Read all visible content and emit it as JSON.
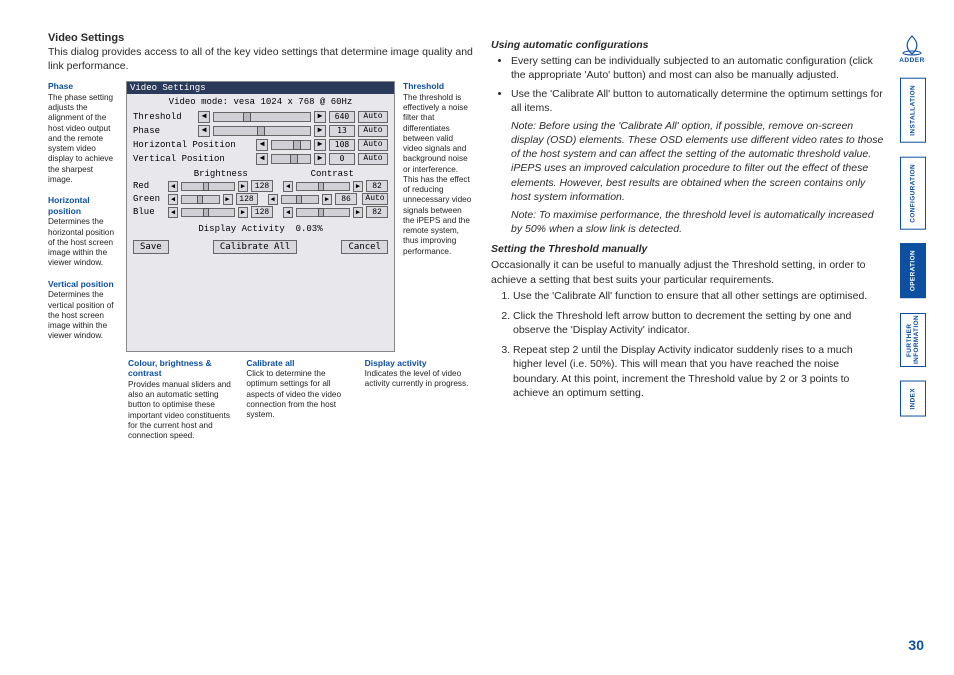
{
  "brand": "ADDER",
  "page_number": "30",
  "title": "Video Settings",
  "intro": "This dialog provides access to all of the key video settings that determine image quality and link performance.",
  "annotations": {
    "phase": {
      "title": "Phase",
      "body": "The phase setting adjusts the alignment of the host video output and the remote system video display to achieve the sharpest image."
    },
    "horizontal": {
      "title": "Horizontal position",
      "body": "Determines the horizontal position of the host screen image within the viewer window."
    },
    "vertical": {
      "title": "Vertical position",
      "body": "Determines the vertical position of the host screen image within the viewer window."
    },
    "threshold": {
      "title": "Threshold",
      "body": "The threshold is effectively a noise filter that differentiates between valid video signals and background noise or interference. This has the effect of reducing unnecessary video signals between the iPEPS and the remote system, thus improving performance."
    },
    "colour": {
      "title": "Colour, brightness & contrast",
      "body": "Provides manual sliders and also an automatic setting button to optimise these important video constituents for the current host and connection speed."
    },
    "calibrate": {
      "title": "Calibrate all",
      "body": "Click to determine the optimum settings for all aspects of video the video connection from the host system."
    },
    "activity": {
      "title": "Display activity",
      "body": "Indicates the level of video activity currently in progress."
    }
  },
  "screenshot": {
    "title": "Video Settings",
    "mode_line": "Video mode: vesa 1024 x 768 @ 60Hz",
    "rows": {
      "threshold": {
        "label": "Threshold",
        "value": "640",
        "btn": "Auto",
        "thumb": "30%"
      },
      "phase": {
        "label": "Phase",
        "value": "13",
        "btn": "Auto",
        "thumb": "45%"
      },
      "hpos": {
        "label": "Horizontal Position",
        "value": "108",
        "btn": "Auto",
        "thumb": "55%"
      },
      "vpos": {
        "label": "Vertical Position",
        "value": "0",
        "btn": "Auto",
        "thumb": "48%"
      }
    },
    "bc_header": {
      "b": "Brightness",
      "c": "Contrast"
    },
    "bc": {
      "red": {
        "label": "Red",
        "b": "128",
        "c": "82"
      },
      "green": {
        "label": "Green",
        "b": "128",
        "c": "86",
        "cbtn": "Auto"
      },
      "blue": {
        "label": "Blue",
        "b": "128",
        "c": "82"
      }
    },
    "activity_label": "Display Activity",
    "activity_value": "0.03%",
    "buttons": {
      "save": "Save",
      "cal": "Calibrate All",
      "cancel": "Cancel"
    }
  },
  "right": {
    "head1": "Using automatic configurations",
    "b1": "Every setting can be individually subjected to an automatic configuration (click the appropriate 'Auto' button) and most can also be manually adjusted.",
    "b2": "Use the 'Calibrate All' button to automatically determine the optimum settings for all items.",
    "note1": "Note: Before using the 'Calibrate All' option, if possible, remove on-screen display (OSD) elements. These OSD elements use different video rates to those of the host system and can affect the setting of the automatic threshold value. iPEPS uses an improved calculation procedure to filter out the effect of these elements. However, best results are obtained when the screen contains only host system information.",
    "note2": "Note: To maximise performance, the threshold level is automatically increased by 50% when a slow link is detected.",
    "head2": "Setting the Threshold manually",
    "intro2": "Occasionally it can be useful to manually adjust the Threshold setting, in order to achieve a setting that best suits your particular requirements.",
    "s1": "Use the 'Calibrate All' function to ensure that all other settings are optimised.",
    "s2": "Click the Threshold left arrow button to decrement the setting by one and observe the 'Display Activity' indicator.",
    "s3": "Repeat step 2 until the Display Activity indicator suddenly rises to a much higher level (i.e. 50%). This will mean that you have reached the noise boundary. At this point, increment the Threshold value by 2 or 3 points to achieve an optimum setting."
  },
  "sidenav": {
    "installation": "INSTALLATION",
    "configuration": "CONFIGURATION",
    "operation": "OPERATION",
    "further": "FURTHER INFORMATION",
    "index": "INDEX"
  }
}
